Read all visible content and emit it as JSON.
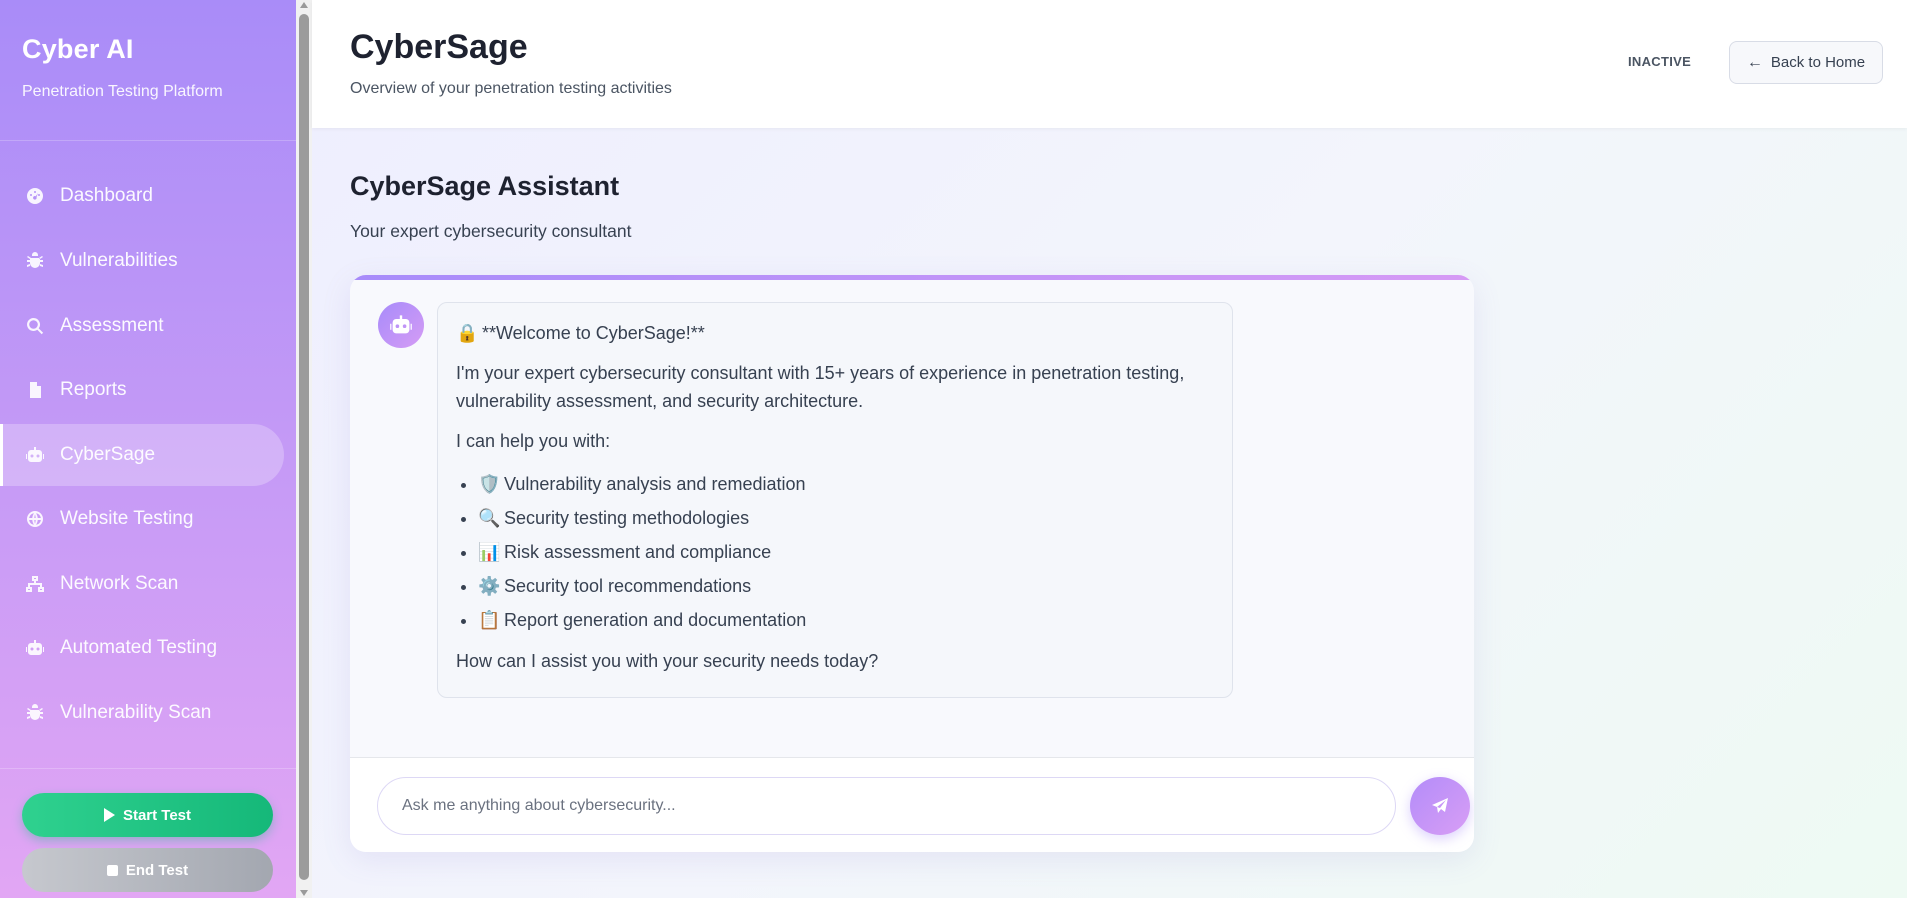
{
  "sidebar": {
    "brand_title": "Cyber AI",
    "brand_subtitle": "Penetration Testing Platform",
    "items": [
      {
        "label": "Dashboard",
        "icon": "dashboard-icon"
      },
      {
        "label": "Vulnerabilities",
        "icon": "bug-icon"
      },
      {
        "label": "Assessment",
        "icon": "search-icon"
      },
      {
        "label": "Reports",
        "icon": "file-icon"
      },
      {
        "label": "CyberSage",
        "icon": "robot-icon",
        "active": true
      },
      {
        "label": "Website Testing",
        "icon": "globe-icon"
      },
      {
        "label": "Network Scan",
        "icon": "network-icon"
      },
      {
        "label": "Automated Testing",
        "icon": "robot-icon"
      },
      {
        "label": "Vulnerability Scan",
        "icon": "bug-icon"
      }
    ],
    "start_label": "Start Test",
    "end_label": "End Test"
  },
  "header": {
    "title": "CyberSage",
    "subtitle": "Overview of your penetration testing activities",
    "status": "INACTIVE",
    "back_label": "Back to Home"
  },
  "assistant": {
    "title": "CyberSage Assistant",
    "subtitle": "Your expert cybersecurity consultant"
  },
  "message": {
    "welcome_emoji": "🔒",
    "welcome": "**Welcome to CyberSage!**",
    "intro": "I'm your expert cybersecurity consultant with 15+ years of experience in penetration testing, vulnerability assessment, and security architecture.",
    "help_intro": "I can help you with:",
    "items": [
      {
        "emoji": "🛡️",
        "text": "Vulnerability analysis and remediation"
      },
      {
        "emoji": "🔍",
        "text": "Security testing methodologies"
      },
      {
        "emoji": "📊",
        "text": "Risk assessment and compliance"
      },
      {
        "emoji": "⚙️",
        "text": "Security tool recommendations"
      },
      {
        "emoji": "📋",
        "text": "Report generation and documentation"
      }
    ],
    "closing": "How can I assist you with your security needs today?"
  },
  "input": {
    "placeholder": "Ask me anything about cybersecurity..."
  },
  "colors": {
    "accent": "#a78bfa",
    "start_green": "#15b879",
    "end_gray": "#a3a7b0"
  }
}
